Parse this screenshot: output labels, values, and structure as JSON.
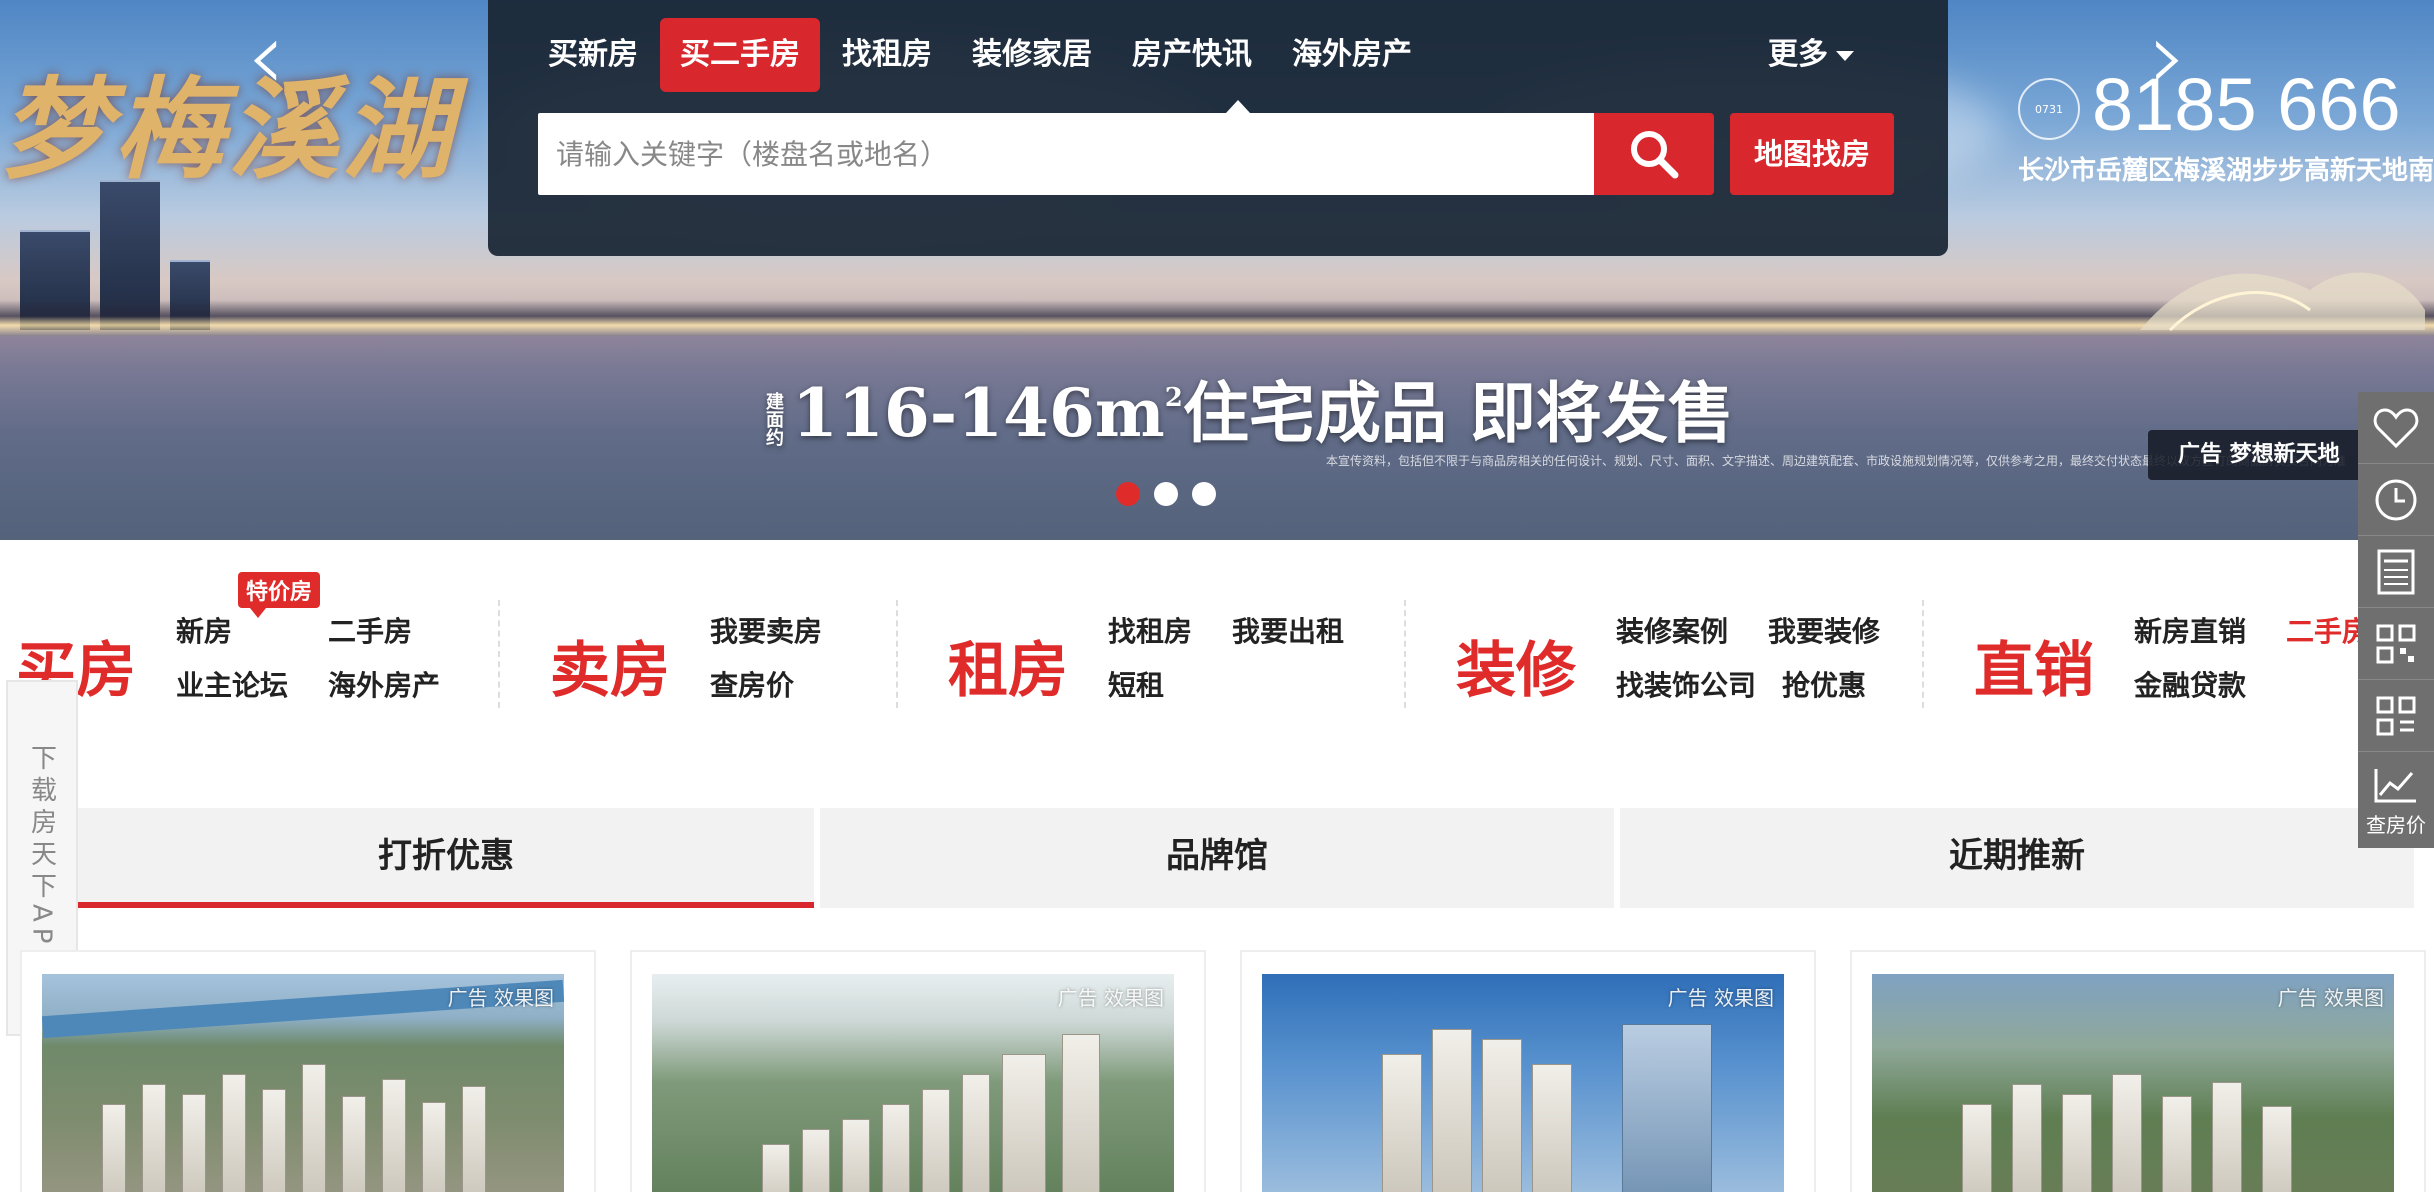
{
  "banner": {
    "calligraphy": "梦梅溪湖",
    "slogan_prefix": "建面约",
    "slogan": "116-146m",
    "slogan_sup": "2",
    "slogan_rest": "住宅成品 即将发售",
    "fine_print": "本宣传资料，包括但不限于与商品房相关的任何设计、规划、尺寸、面积、文字描述、周边建筑配套、市政设施规划情况等，仅供参考之用，最终交付状态最终以双方签订的商品房买卖合同为准",
    "phone": "8185 666",
    "phone_logo": "0731",
    "address": "长沙市岳麓区梅溪湖步步高新天地南",
    "ad_label": "广告 梦想新天地",
    "active_dot": 0,
    "dots": 3
  },
  "search": {
    "tabs": [
      "买新房",
      "买二手房",
      "找租房",
      "装修家居",
      "房产快讯",
      "海外房产"
    ],
    "active_tab": 1,
    "more_label": "更多",
    "placeholder": "请输入关键字（楼盘名或地名）",
    "map_button": "地图找房"
  },
  "categories": [
    {
      "title": "买房",
      "badge": "特价房",
      "links": [
        "新房",
        "二手房",
        "业主论坛",
        "海外房产"
      ]
    },
    {
      "title": "卖房",
      "links": [
        "我要卖房",
        "查房价"
      ]
    },
    {
      "title": "租房",
      "links": [
        "找租房",
        "我要出租",
        "短租"
      ]
    },
    {
      "title": "装修",
      "links": [
        "装修案例",
        "我要装修",
        "找装饰公司",
        "抢优惠"
      ]
    },
    {
      "title": "直销",
      "links": [
        "新房直销",
        "二手房",
        "金融贷款"
      ]
    }
  ],
  "tabs": [
    "打折优惠",
    "品牌馆",
    "近期推新"
  ],
  "active_tab": 0,
  "cards": [
    {
      "tag": "广告 效果图"
    },
    {
      "tag": "广告 效果图"
    },
    {
      "tag": "广告 效果图"
    },
    {
      "tag": "广告 效果图"
    }
  ],
  "download_app": "下载房天下APP",
  "sidebar": {
    "items": [
      "heart-icon",
      "clock-icon",
      "calculator-icon",
      "qrcode-icon",
      "app-qrcode-icon",
      "trend-icon"
    ],
    "price_label": "查房价"
  },
  "colors": {
    "accent": "#d9272e",
    "panel": "#1a2634"
  }
}
